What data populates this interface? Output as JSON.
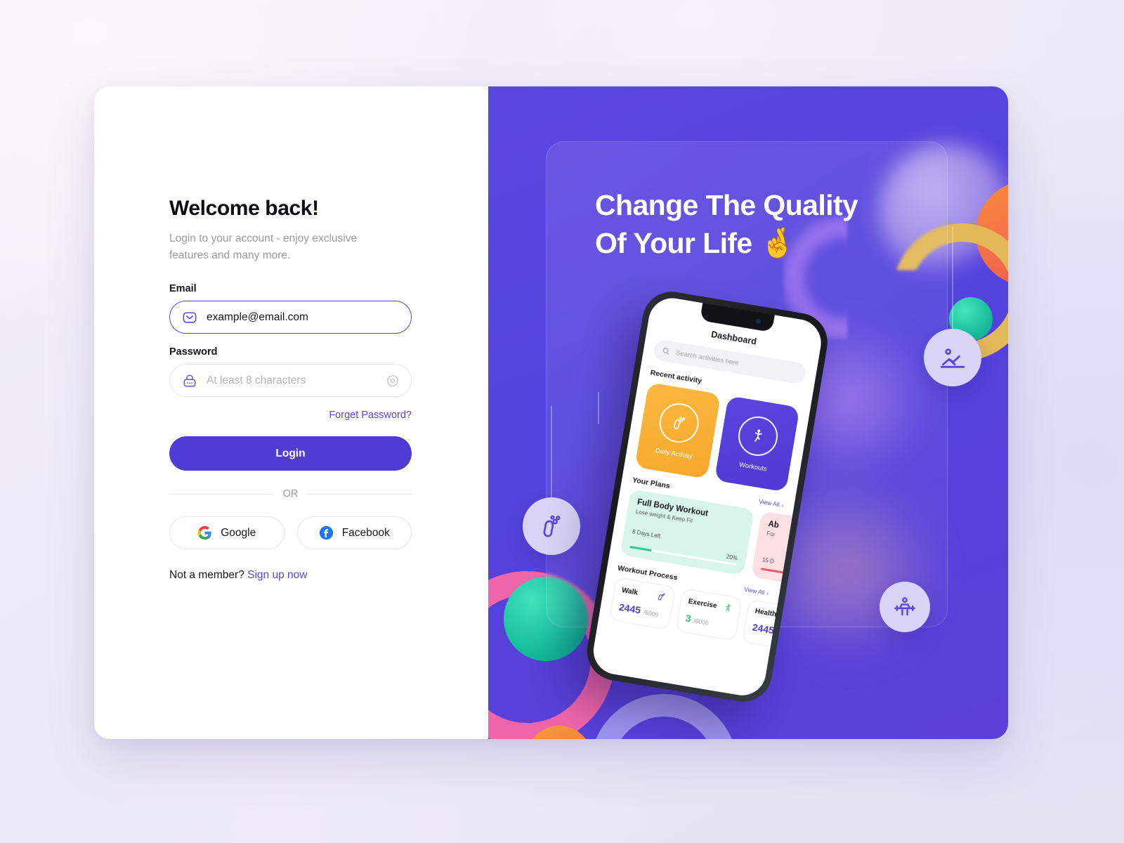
{
  "login": {
    "title": "Welcome back!",
    "subtitle": "Login to your account - enjoy exclusive features and many more.",
    "email_label": "Email",
    "email_value": "example@email.com",
    "email_icon": "envelope-icon",
    "password_label": "Password",
    "password_placeholder": "At least 8 characters",
    "password_icon": "lock-icon",
    "toggle_icon": "eye-icon",
    "forget_password": "Forget Password?",
    "login_button": "Login",
    "divider_text": "OR",
    "google_button": "Google",
    "facebook_button": "Facebook",
    "member_prompt": "Not a member?",
    "signup_link": "Sign up now"
  },
  "promo": {
    "headline_line1": "Change The Quality",
    "headline_line2": "Of Your Life",
    "headline_emoji": "🤞",
    "badges": [
      {
        "name": "rowing-machine-icon"
      },
      {
        "name": "footprint-icon"
      },
      {
        "name": "bench-press-icon"
      }
    ]
  },
  "phone": {
    "title": "Dashboard",
    "search_placeholder": "Search activities here",
    "recent_activity_label": "Recent activity",
    "activity_cards": [
      {
        "label": "Daily Activity",
        "icon": "footprint-icon",
        "color": "#f7a82e"
      },
      {
        "label": "Workouts",
        "icon": "yoga-pose-icon",
        "color": "#4e39d4"
      }
    ],
    "plans_label": "Your Plans",
    "view_all": "View All",
    "plans": [
      {
        "title": "Full Body Workout",
        "subtitle": "Lose weight & Keep Fit",
        "days_left": "8 Days Left",
        "percent": "20%",
        "progress": 20
      },
      {
        "title": "Ab",
        "subtitle": "For",
        "days_left": "15 D",
        "percent": "",
        "progress": 35
      }
    ],
    "process_label": "Workout Process",
    "stats": [
      {
        "name": "Walk",
        "value": "2445",
        "goal": "/6000",
        "icon": "footprint-icon"
      },
      {
        "name": "Exercise",
        "value": "3",
        "goal": "/6000",
        "icon": "stretch-figure-icon"
      },
      {
        "name": "Health",
        "value": "2445",
        "goal": "",
        "icon": "heart-icon"
      }
    ]
  },
  "colors": {
    "primary": "#4f3cd4",
    "link": "#5b46d9",
    "panel": "#5343dc",
    "orange": "#f7a82e",
    "teal": "#14b898",
    "pink": "#ef66a8",
    "gold": "#e2b858"
  }
}
